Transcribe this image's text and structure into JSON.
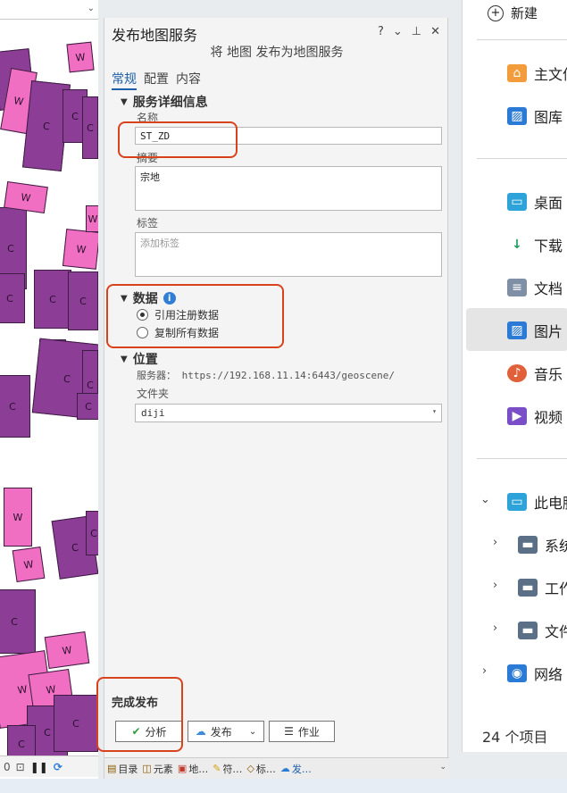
{
  "map": {
    "parcels": [
      {
        "type": "c",
        "label": "C"
      },
      {
        "type": "w",
        "label": "W"
      },
      {
        "type": "c",
        "label": "C"
      },
      {
        "type": "w",
        "label": "W"
      },
      {
        "type": "c",
        "label": "C"
      },
      {
        "type": "c",
        "label": "C"
      },
      {
        "type": "c",
        "label": "C"
      },
      {
        "type": "w",
        "label": "W"
      },
      {
        "type": "w",
        "label": "W"
      },
      {
        "type": "w",
        "label": "W"
      },
      {
        "type": "c",
        "label": "C"
      },
      {
        "type": "c",
        "label": "C"
      },
      {
        "type": "c",
        "label": "C"
      },
      {
        "type": "c",
        "label": "C"
      },
      {
        "type": "c",
        "label": "C"
      },
      {
        "type": "c",
        "label": "C"
      },
      {
        "type": "c",
        "label": "C"
      },
      {
        "type": "c",
        "label": "C"
      },
      {
        "type": "w",
        "label": "W"
      },
      {
        "type": "c",
        "label": "C"
      },
      {
        "type": "c",
        "label": "C"
      },
      {
        "type": "w",
        "label": "W"
      },
      {
        "type": "c",
        "label": "C"
      },
      {
        "type": "w",
        "label": "W"
      },
      {
        "type": "w",
        "label": "W"
      },
      {
        "type": "w",
        "label": "W"
      },
      {
        "type": "c",
        "label": "C"
      },
      {
        "type": "c",
        "label": "C"
      },
      {
        "type": "c",
        "label": "C"
      }
    ]
  },
  "panel": {
    "title": "发布地图服务",
    "subtitle": "将 地图 发布为地图服务",
    "controls": {
      "help": "?",
      "menu": "⌄",
      "pin": "⊥",
      "close": "✕"
    },
    "tabs": [
      "常规",
      "配置",
      "内容"
    ],
    "service_section": {
      "header": "服务详细信息",
      "name_label": "名称",
      "name_value": "ST_ZD",
      "summary_label": "摘要",
      "summary_value": "宗地",
      "tags_label": "标签",
      "tags_placeholder": "添加标签"
    },
    "data_section": {
      "header": "数据",
      "options": [
        {
          "label": "引用注册数据",
          "selected": true
        },
        {
          "label": "复制所有数据",
          "selected": false
        }
      ]
    },
    "location_section": {
      "header": "位置",
      "server_label": "服务器：",
      "server_value": "https://192.168.11.14:6443/geoscene/",
      "folder_label": "文件夹",
      "folder_value": "diji"
    },
    "finish_label": "完成发布",
    "buttons": {
      "analyze": "分析",
      "publish": "发布",
      "jobs": "作业"
    },
    "bottom_tabs": [
      {
        "icon": "catalog-icon",
        "label": "目录"
      },
      {
        "icon": "elements-icon",
        "label": "元素"
      },
      {
        "icon": "geoprocessing-icon",
        "label": "地…"
      },
      {
        "icon": "symbology-icon",
        "label": "符…"
      },
      {
        "icon": "labeling-icon",
        "label": "标…"
      },
      {
        "icon": "publish-icon",
        "label": "发…"
      }
    ]
  },
  "explorer": {
    "new_label": "新建",
    "items": [
      {
        "label": "主文件夹",
        "icon": "home-icon",
        "color": "#f39c3b"
      },
      {
        "label": "图库",
        "icon": "gallery-icon",
        "color": "#2b7bd6"
      },
      {
        "label": "桌面",
        "icon": "desktop-icon",
        "color": "#2ea3d9"
      },
      {
        "label": "下载",
        "icon": "download-icon",
        "color": "#1e9e5a"
      },
      {
        "label": "文档",
        "icon": "documents-icon",
        "color": "#7f8fa6"
      },
      {
        "label": "图片",
        "icon": "pictures-icon",
        "color": "#2b7bd6"
      },
      {
        "label": "音乐",
        "icon": "music-icon",
        "color": "#e0603a"
      },
      {
        "label": "视频",
        "icon": "videos-icon",
        "color": "#7a4ec7"
      }
    ],
    "tree": [
      {
        "label": "此电脑",
        "icon": "this-pc-icon"
      },
      {
        "label": "系统",
        "icon": "drive-icon"
      },
      {
        "label": "工作",
        "icon": "drive-icon"
      },
      {
        "label": "文件",
        "icon": "drive-icon"
      },
      {
        "label": "网络",
        "icon": "network-icon"
      }
    ],
    "count": "24 个项目"
  }
}
